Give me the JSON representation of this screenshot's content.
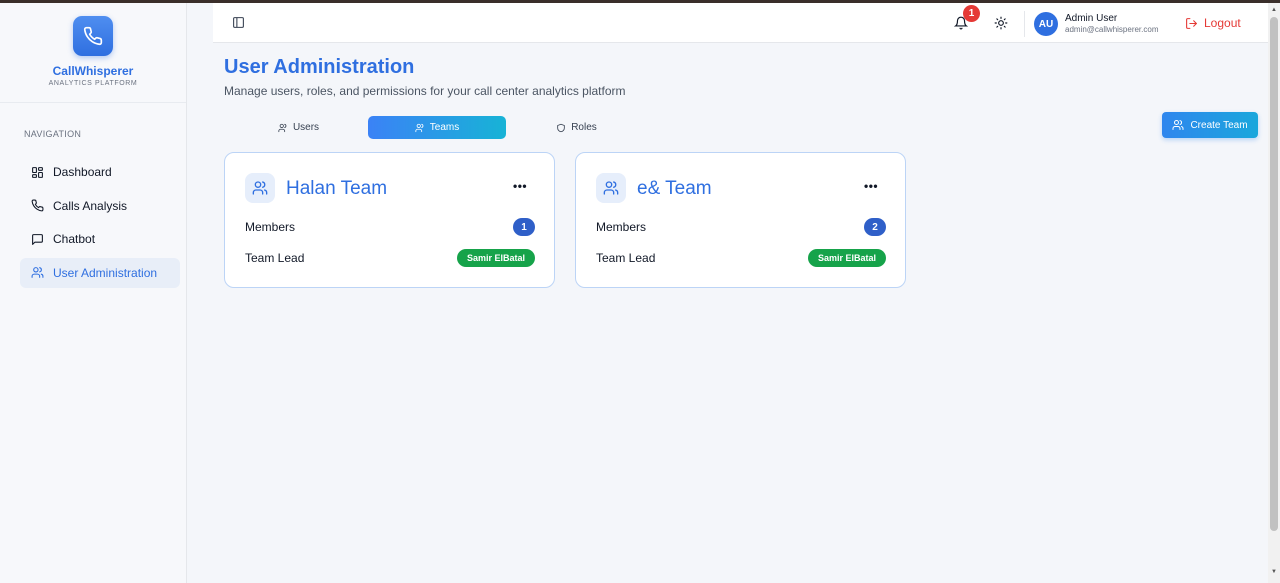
{
  "brand": {
    "name": "CallWhisperer",
    "subtitle": "ANALYTICS PLATFORM"
  },
  "sidebar": {
    "heading": "NAVIGATION",
    "items": [
      {
        "label": "Dashboard",
        "icon": "dashboard-icon"
      },
      {
        "label": "Calls Analysis",
        "icon": "phone-icon"
      },
      {
        "label": "Chatbot",
        "icon": "chat-icon"
      },
      {
        "label": "User Administration",
        "icon": "users-icon",
        "active": true
      }
    ]
  },
  "header": {
    "notification_count": "1",
    "user": {
      "initials": "AU",
      "name": "Admin User",
      "email": "admin@callwhisperer.com"
    },
    "logout_label": "Logout"
  },
  "main": {
    "title": "User Administration",
    "subtitle": "Manage users, roles, and permissions for your call center analytics platform",
    "tabs": [
      {
        "label": "Users",
        "active": false
      },
      {
        "label": "Teams",
        "active": true
      },
      {
        "label": "Roles",
        "active": false
      }
    ],
    "create_button": "Create Team",
    "teams": [
      {
        "name": "Halan Team",
        "members_label": "Members",
        "members_count": "1",
        "lead_label": "Team Lead",
        "lead": "Samir ElBatal"
      },
      {
        "name": "e& Team",
        "members_label": "Members",
        "members_count": "2",
        "lead_label": "Team Lead",
        "lead": "Samir ElBatal"
      }
    ]
  },
  "colors": {
    "accent": "#2f6fe0",
    "success": "#16a34a",
    "danger": "#e53935",
    "card_border": "#bcd4f6"
  }
}
